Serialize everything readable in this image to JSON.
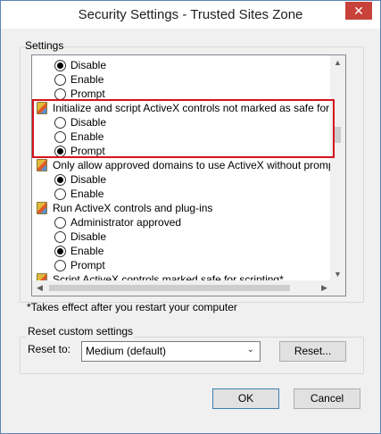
{
  "window": {
    "title": "Security Settings - Trusted Sites Zone",
    "close_glyph": "✕"
  },
  "settings": {
    "label": "Settings",
    "rows": [
      {
        "kind": "option",
        "label": "Disable",
        "checked": true
      },
      {
        "kind": "option",
        "label": "Enable",
        "checked": false
      },
      {
        "kind": "option",
        "label": "Prompt",
        "checked": false
      },
      {
        "kind": "category",
        "label": "Initialize and script ActiveX controls not marked as safe for script"
      },
      {
        "kind": "option",
        "label": "Disable",
        "checked": false
      },
      {
        "kind": "option",
        "label": "Enable",
        "checked": false
      },
      {
        "kind": "option",
        "label": "Prompt",
        "checked": true
      },
      {
        "kind": "category",
        "label": "Only allow approved domains to use ActiveX without prompt"
      },
      {
        "kind": "option",
        "label": "Disable",
        "checked": true
      },
      {
        "kind": "option",
        "label": "Enable",
        "checked": false
      },
      {
        "kind": "category",
        "label": "Run ActiveX controls and plug-ins"
      },
      {
        "kind": "option",
        "label": "Administrator approved",
        "checked": false
      },
      {
        "kind": "option",
        "label": "Disable",
        "checked": false
      },
      {
        "kind": "option",
        "label": "Enable",
        "checked": true
      },
      {
        "kind": "option",
        "label": "Prompt",
        "checked": false
      },
      {
        "kind": "category",
        "label": "Script ActiveX controls marked safe for scripting*"
      }
    ]
  },
  "note": "*Takes effect after you restart your computer",
  "reset": {
    "group_label": "Reset custom settings",
    "reset_to_label": "Reset to:",
    "selected": "Medium (default)",
    "button": "Reset..."
  },
  "buttons": {
    "ok": "OK",
    "cancel": "Cancel"
  },
  "colors": {
    "highlight": "#d6131f",
    "window_border": "#5b86b8",
    "close_bg": "#c7423a"
  }
}
